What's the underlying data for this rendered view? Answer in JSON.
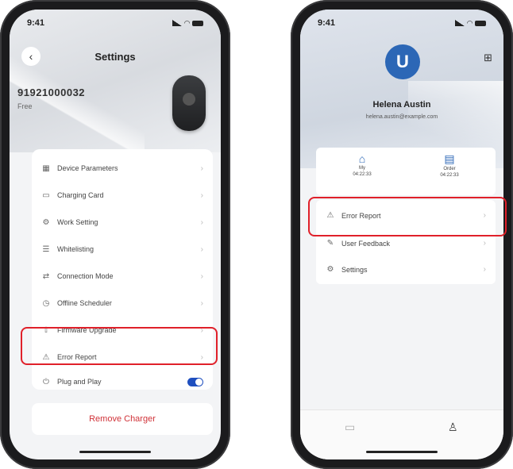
{
  "left": {
    "status_time": "9:41",
    "title": "Settings",
    "device_id": "91921000032",
    "device_sub": "Free",
    "menu": [
      {
        "label": "Device Parameters",
        "icon": "params-icon"
      },
      {
        "label": "Charging Card",
        "icon": "card-icon"
      },
      {
        "label": "Work Setting",
        "icon": "work-setting-icon"
      },
      {
        "label": "Whitelisting",
        "icon": "list-icon"
      },
      {
        "label": "Connection Mode",
        "icon": "connection-icon"
      },
      {
        "label": "Offline Scheduler",
        "icon": "scheduler-icon"
      },
      {
        "label": "Firmware Upgrade",
        "icon": "upgrade-icon"
      },
      {
        "label": "Error Report",
        "icon": "warning-icon"
      },
      {
        "label": "Plug and Play",
        "icon": "plug-icon",
        "toggle": true
      }
    ],
    "remove_label": "Remove Charger"
  },
  "right": {
    "status_time": "9:41",
    "avatar_letter": "U",
    "user_name": "Helena Austin",
    "user_email": "helena.austin@example.com",
    "stats": [
      {
        "label": "My",
        "value": "04:22:33",
        "icon": "charger-icon"
      },
      {
        "label": "Order",
        "value": "04:22:33",
        "icon": "order-icon"
      }
    ],
    "menu": [
      {
        "label": "Error Report",
        "icon": "warning-icon"
      },
      {
        "label": "User Feedback",
        "icon": "feedback-icon"
      },
      {
        "label": "Settings",
        "icon": "settings-icon"
      }
    ]
  },
  "colors": {
    "accent": "#1f4fbf",
    "highlight": "#e0202a",
    "danger": "#d03238",
    "avatar": "#2c67b6"
  }
}
